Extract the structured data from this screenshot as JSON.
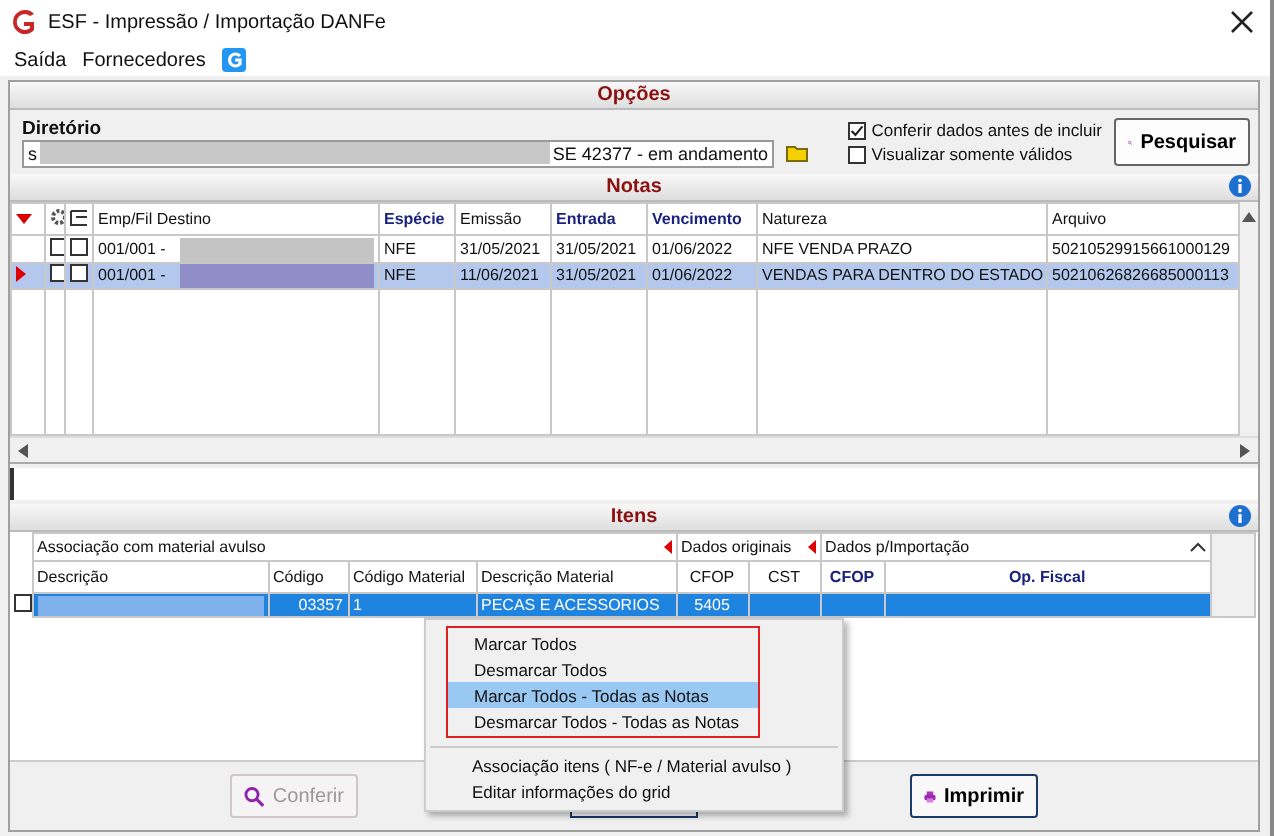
{
  "window": {
    "title": "ESF - Impressão / Importação DANFe"
  },
  "menu": [
    "Saída",
    "Fornecedores"
  ],
  "options": {
    "title": "Opções",
    "directory_label": "Diretório",
    "directory_value_start": "s",
    "directory_value_end": "SE 42377 - em andamento",
    "checks": [
      {
        "label": "Conferir dados antes de incluir",
        "checked": true
      },
      {
        "label": "Visualizar somente válidos",
        "checked": false
      }
    ],
    "search_button": "Pesquisar"
  },
  "notes": {
    "title": "Notas",
    "columns": [
      {
        "label": "Emp/Fil Destino",
        "emphasized": false
      },
      {
        "label": "Espécie",
        "emphasized": true
      },
      {
        "label": "Emissão",
        "emphasized": false
      },
      {
        "label": "Entrada",
        "emphasized": true
      },
      {
        "label": "Vencimento",
        "emphasized": true
      },
      {
        "label": "Natureza",
        "emphasized": false
      },
      {
        "label": "Arquivo",
        "emphasized": false
      }
    ],
    "rows": [
      {
        "selected": false,
        "check_1": false,
        "check_2": false,
        "cells": [
          "001/001 -",
          "NFE",
          "31/05/2021",
          "31/05/2021",
          "01/06/2022",
          "NFE VENDA PRAZO",
          "50210529915661000129"
        ]
      },
      {
        "selected": true,
        "check_1": false,
        "check_2": false,
        "cells": [
          "001/001 -",
          "NFE",
          "11/06/2021",
          "31/05/2021",
          "01/06/2022",
          "VENDAS PARA DENTRO DO ESTADO",
          "50210626826685000113"
        ]
      }
    ]
  },
  "items": {
    "title": "Itens",
    "groups": [
      {
        "label": "Associação com material avulso",
        "collapsible": true
      },
      {
        "label": "Dados originais",
        "collapsible": true
      },
      {
        "label": "Dados p/Importação",
        "collapsible": false
      }
    ],
    "columns": [
      {
        "label": "Descrição",
        "emphasized": false
      },
      {
        "label": "Código",
        "emphasized": false
      },
      {
        "label": "Código Material",
        "emphasized": false
      },
      {
        "label": "Descrição Material",
        "emphasized": false
      },
      {
        "label": "CFOP",
        "emphasized": false
      },
      {
        "label": "CST",
        "emphasized": false
      },
      {
        "label": "CFOP",
        "emphasized": true
      },
      {
        "label": "Op. Fiscal",
        "emphasized": true
      }
    ],
    "rows": [
      {
        "selected": true,
        "checked": false,
        "cells": [
          "",
          "03357",
          "1",
          "PECAS E ACESSORIOS",
          "5405",
          "",
          "",
          ""
        ]
      }
    ]
  },
  "buttons": [
    {
      "label": "Conferir",
      "disabled": true,
      "kind": "search"
    },
    {
      "label": "Imprimir",
      "disabled": false,
      "kind": "print"
    }
  ],
  "context_menu": [
    {
      "label": "Marcar Todos",
      "selected": false,
      "kind": "boxed"
    },
    {
      "label": "Desmarcar Todos",
      "selected": false,
      "kind": "boxed"
    },
    {
      "label": "Marcar Todos - Todas as Notas",
      "selected": true,
      "kind": "boxed"
    },
    {
      "label": "Desmarcar Todos - Todas as Notas",
      "selected": false,
      "kind": "boxed"
    },
    {
      "label": "Associação itens ( NF-e / Material avulso )",
      "selected": false,
      "kind": "plain"
    },
    {
      "label": "Editar informações do grid",
      "selected": false,
      "kind": "plain"
    }
  ]
}
